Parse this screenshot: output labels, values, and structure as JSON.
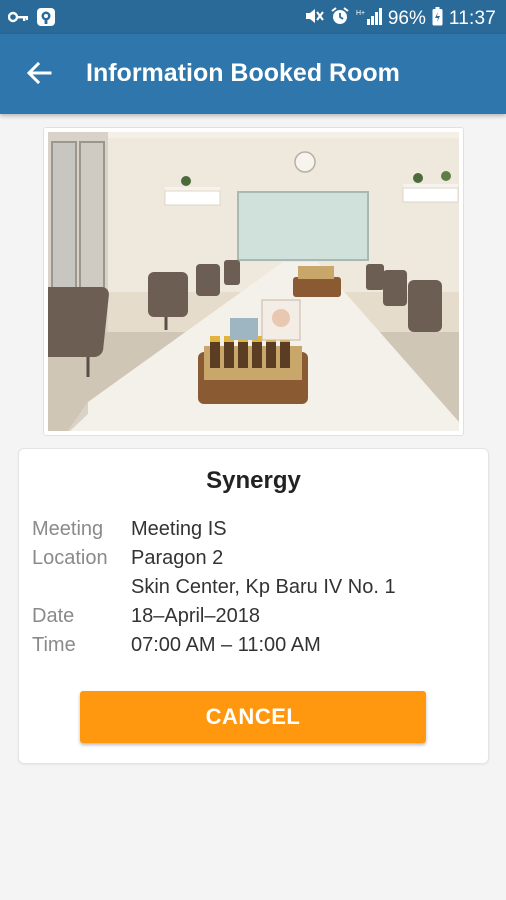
{
  "status_bar": {
    "battery": "96%",
    "time": "11:37",
    "icons": [
      "key-icon",
      "vpn-icon",
      "mute-icon",
      "alarm-icon",
      "signal-icon",
      "battery-icon"
    ]
  },
  "header": {
    "back_icon": "arrow-left-icon",
    "title": "Information Booked Room"
  },
  "room": {
    "name": "Synergy",
    "details": {
      "meeting_label": "Meeting",
      "meeting_value": "Meeting IS",
      "location_label": "Location",
      "location_line1": "Paragon 2",
      "location_line2": "Skin Center, Kp Baru IV No. 1",
      "date_label": "Date",
      "date_value": "18–April–2018",
      "time_label": "Time",
      "time_value": "07:00 AM – 11:00 AM"
    }
  },
  "actions": {
    "cancel_label": "CANCEL"
  },
  "colors": {
    "status_bar": "#2a6a99",
    "app_bar": "#2e76ab",
    "cancel_button": "#ff980f"
  }
}
